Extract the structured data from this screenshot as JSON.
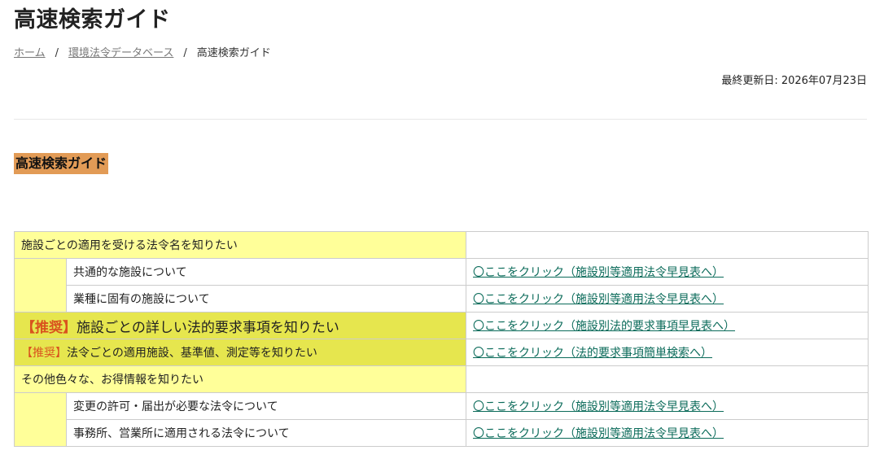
{
  "page": {
    "title": "高速検索ガイド",
    "updated": "最終更新日: 2026年07月23日"
  },
  "breadcrumb": {
    "home": "ホーム",
    "separator": "/",
    "database": "環境法令データベース",
    "current": "高速検索ガイド"
  },
  "section": {
    "heading": "高速検索ガイド"
  },
  "table": {
    "rows": [
      {
        "label": "施設ごとの適用を受ける法令名を知りたい",
        "link": ""
      },
      {
        "label": "共通的な施設について",
        "link": "〇ここをクリック（施設別等適用法令早見表へ）"
      },
      {
        "label": "業種に固有の施設について",
        "link": "〇ここをクリック（施設別等適用法令早見表へ）"
      },
      {
        "mark": "【推奨】",
        "label": "施設ごとの詳しい法的要求事項を知りたい",
        "link": "〇ここをクリック（施設別法的要求事項早見表へ）"
      },
      {
        "mark": "【推奨】",
        "label": "法令ごとの適用施設、基準値、測定等を知りたい",
        "link": "〇ここをクリック（法的要求事項簡単検索へ）"
      },
      {
        "label": "その他色々な、お得情報を知りたい",
        "link": ""
      },
      {
        "label": "変更の許可・届出が必要な法令について",
        "link": "〇ここをクリック（施設別等適用法令早見表へ）"
      },
      {
        "label": "事務所、営業所に適用される法令について",
        "link": "〇ここをクリック（施設別等適用法令早見表へ）"
      }
    ]
  },
  "colors": {
    "heading_bg": "#e29b56",
    "category_bg": "#ffff99",
    "recommend_bg": "#e6e64e",
    "recommend_mark": "#d9531e",
    "link": "#0b6b5a"
  }
}
